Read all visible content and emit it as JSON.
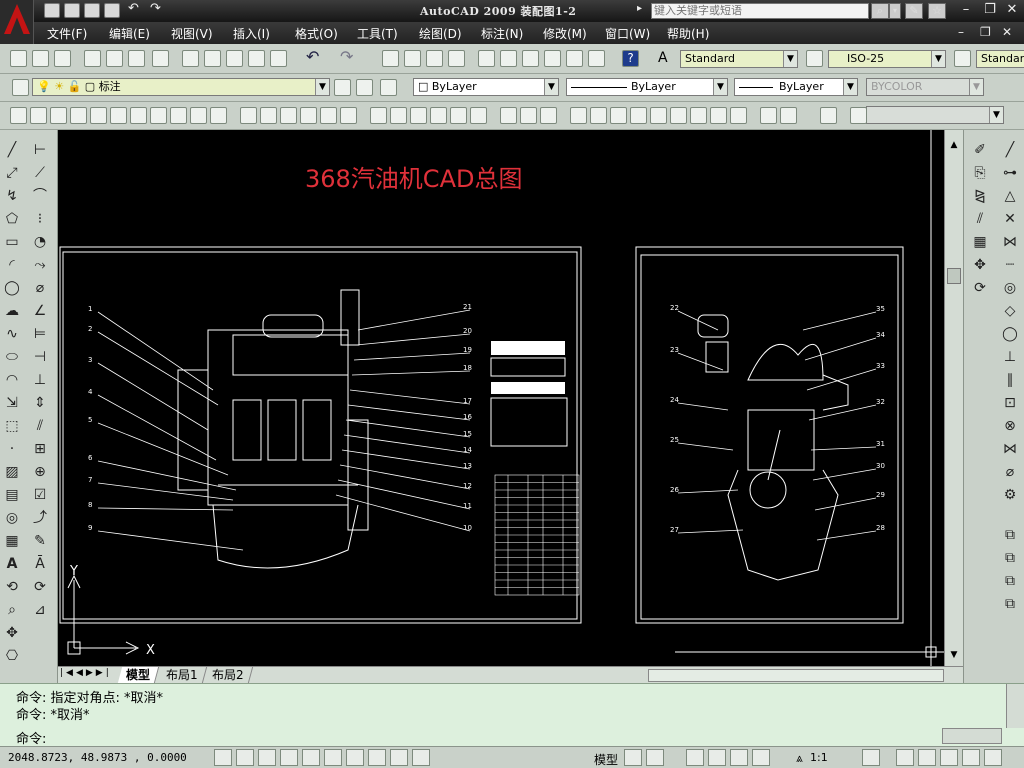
{
  "window": {
    "title": "AutoCAD 2009  装配图1-2",
    "search_placeholder": "键入关键字或短语"
  },
  "menu": [
    "文件(F)",
    "编辑(E)",
    "视图(V)",
    "插入(I)",
    "格式(O)",
    "工具(T)",
    "绘图(D)",
    "标注(N)",
    "修改(M)",
    "窗口(W)",
    "帮助(H)"
  ],
  "toolbar": {
    "text_style": "Standard",
    "dim_style": "ISO-25",
    "table_style": "Standar",
    "layer": "标注",
    "color": "ByLayer",
    "linetype": "ByLayer",
    "lineweight": "ByLayer",
    "plotstyle": "BYCOLOR"
  },
  "drawing": {
    "title": "368汽油机CAD总图",
    "ucs_y": "Y",
    "ucs_x": "X",
    "left_callouts": [
      "1",
      "2",
      "3",
      "4",
      "5",
      "6",
      "7",
      "8",
      "9"
    ],
    "right_of_left_callouts": [
      "21",
      "20",
      "19",
      "18",
      "17",
      "16",
      "15",
      "14",
      "13",
      "12",
      "11",
      "10"
    ],
    "right_view_left_callouts": [
      "22",
      "23",
      "24",
      "25",
      "26",
      "27"
    ],
    "right_view_right_callouts": [
      "35",
      "34",
      "33",
      "32",
      "31",
      "30",
      "29",
      "28"
    ]
  },
  "tabs": [
    "模型",
    "布局1",
    "布局2"
  ],
  "command": {
    "history": [
      "命令: 指定对角点: *取消*",
      "命令: *取消*"
    ],
    "prompt": "命令:"
  },
  "status": {
    "coordinates": "2048.8723,  48.9873 ,  0.0000",
    "model_label": "模型",
    "scale": "1:1"
  },
  "colors": {
    "title_red": "#e0313a",
    "canvas": "#000000",
    "command_bg": "#ddf0dd",
    "combo_bg": "#e8f0c8"
  }
}
